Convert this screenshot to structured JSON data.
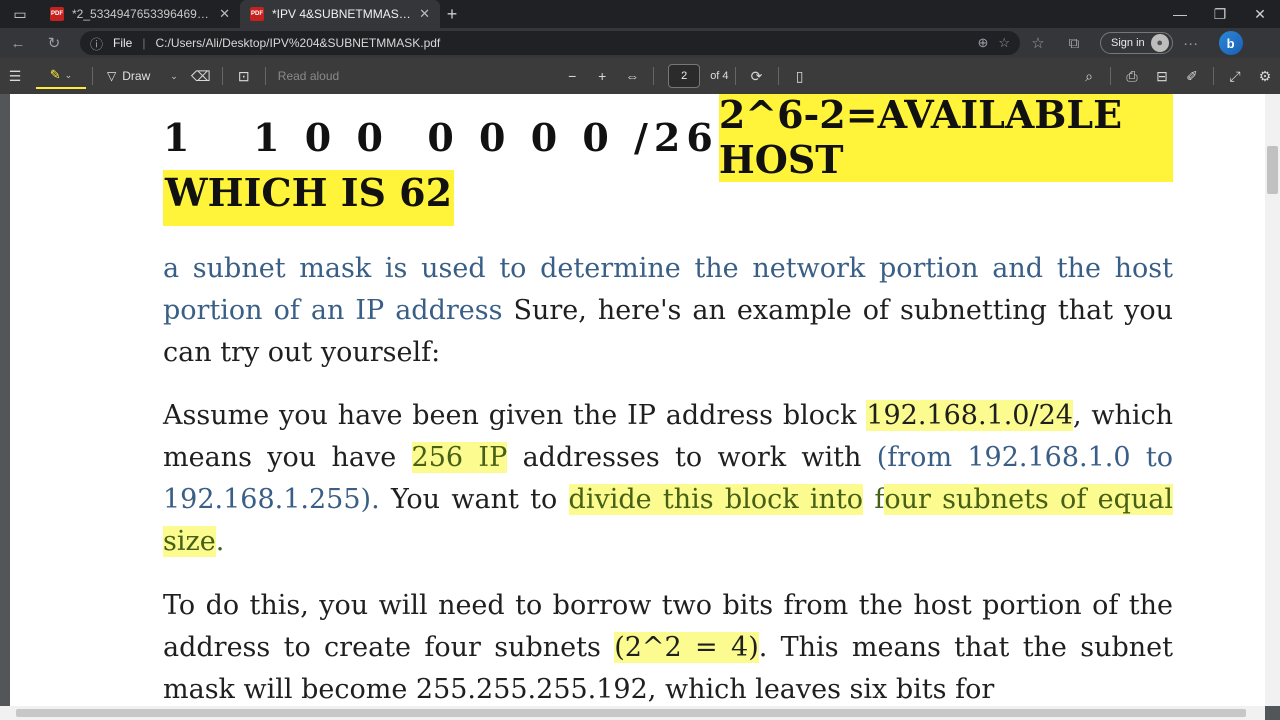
{
  "tabs": [
    {
      "title": "*2_5334947653396469268.pdf",
      "active": false
    },
    {
      "title": "*IPV 4&SUBNETMMASK.pdf",
      "active": true
    }
  ],
  "address": {
    "file_label": "File",
    "url": "C:/Users/Ali/Desktop/IPV%204&SUBNETMMASK.pdf"
  },
  "signin_label": "Sign in",
  "toolbar": {
    "draw_label": "Draw",
    "read_aloud_label": "Read aloud",
    "page_number": "2",
    "page_total": "of 4"
  },
  "content": {
    "bits": "1   1 0 0  0 0 0 0 /26",
    "available_host": "2^6-2=AVAILABLE HOST",
    "which_is": "WHICH IS 62",
    "p1_blue": "a subnet mask is used to determine the network portion and the host portion of an IP address",
    "p1_rest": " Sure, here's an example of subnetting that you can try out yourself:",
    "p2_a": "Assume you have been given the IP address block ",
    "p2_block": "192.168.1.0/24",
    "p2_b": ", which means you have ",
    "p2_256": "256 IP",
    "p2_c": " addresses to work with ",
    "p2_range": "(from 192.168.1.0 to 192.168.1.255).",
    "p2_d": " You want to ",
    "p2_divide": "divide this block into",
    "p2_f": " f",
    "p2_four": "our subnets of equal size",
    "p2_end": ".",
    "p3_a": "To do this, you will need to borrow two bits from the host portion of the address to create four subnets ",
    "p3_calc": "(2^2 = 4)",
    "p3_b": ". This means that the subnet mask will become 255.255.255.192, which leaves six bits for"
  },
  "colors": {
    "highlight_strong": "#fff43a",
    "highlight_soft": "#fbfb8f",
    "link_blue": "#3a5f87"
  }
}
